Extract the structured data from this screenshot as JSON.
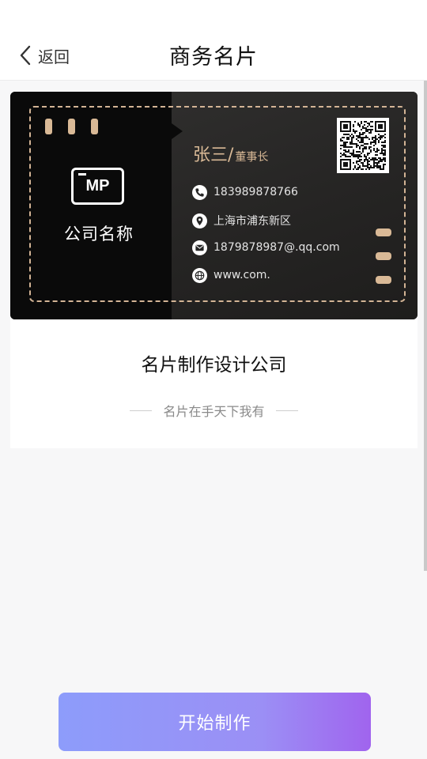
{
  "header": {
    "back_label": "返回",
    "title": "商务名片"
  },
  "card": {
    "logo_text": "MP",
    "company_name": "公司名称",
    "person_name": "张三/",
    "person_role": "董事长",
    "phone": "183989878766",
    "address": "上海市浦东新区",
    "email": "1879878987@.qq.com",
    "website": "www.com.",
    "accent_color": "#d9b996"
  },
  "template": {
    "title": "名片制作设计公司",
    "slogan": "名片在手天下我有"
  },
  "footer": {
    "start_label": "开始制作"
  },
  "icons": [
    "chevron-left-icon",
    "phone-icon",
    "location-icon",
    "mail-icon",
    "globe-icon",
    "qr-code"
  ]
}
